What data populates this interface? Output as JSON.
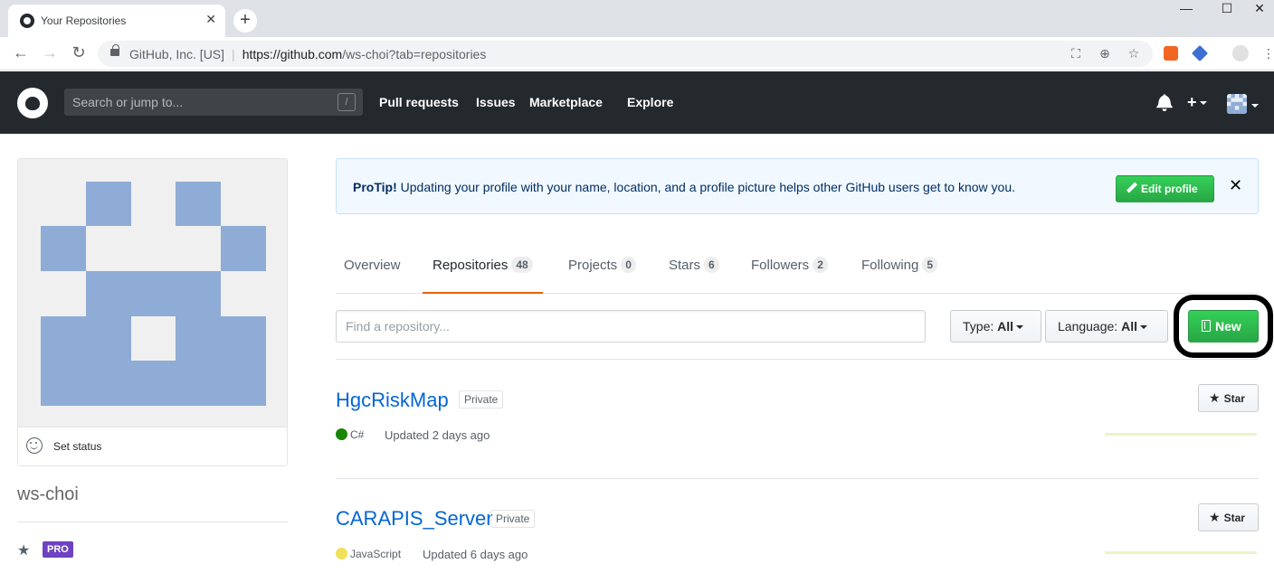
{
  "browser": {
    "tab_title": "Your Repositories",
    "tab_close": "✕",
    "new_tab": "+",
    "url_org": "GitHub, Inc. [US]",
    "url_host": "https://github.com",
    "url_path": "/ws-choi?tab=repositories"
  },
  "header": {
    "search_placeholder": "Search or jump to...",
    "search_shortcut": "/",
    "nav": [
      "Pull requests",
      "Issues",
      "Marketplace",
      "Explore"
    ],
    "plus": "+"
  },
  "profile": {
    "set_status": "Set status",
    "username": "ws-choi",
    "pro_badge": "PRO",
    "avatar_color": "#8eacd6"
  },
  "protip": {
    "label": "ProTip!",
    "text": " Updating your profile with your name, location, and a profile picture helps other GitHub users get to know you.",
    "button": "Edit profile",
    "close": "✕"
  },
  "tabs": [
    {
      "label": "Overview",
      "count": ""
    },
    {
      "label": "Repositories",
      "count": "48"
    },
    {
      "label": "Projects",
      "count": "0"
    },
    {
      "label": "Stars",
      "count": "6"
    },
    {
      "label": "Followers",
      "count": "2"
    },
    {
      "label": "Following",
      "count": "5"
    }
  ],
  "filters": {
    "find_placeholder": "Find a repository...",
    "type_label": "Type:",
    "type_value": "All",
    "language_label": "Language:",
    "language_value": "All",
    "new_button": "New"
  },
  "repos": [
    {
      "name": "HgcRiskMap",
      "visibility": "Private",
      "language": "C#",
      "language_color": "#178600",
      "updated": "Updated 2 days ago",
      "star": "Star"
    },
    {
      "name": "CARAPIS_Server",
      "visibility": "Private",
      "language": "JavaScript",
      "language_color": "#f1e05a",
      "updated": "Updated 6 days ago",
      "star": "Star"
    }
  ]
}
